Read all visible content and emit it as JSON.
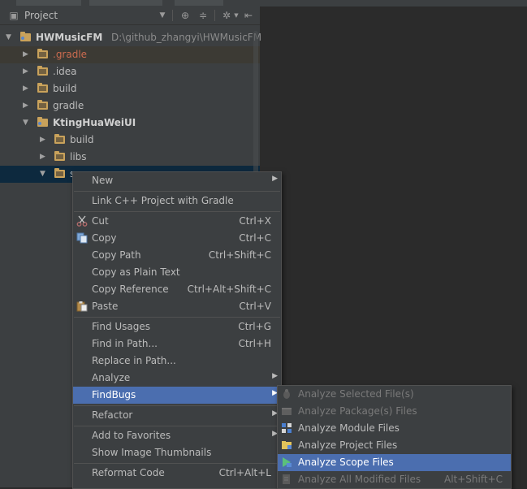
{
  "panel": {
    "title": "Project"
  },
  "tree": [
    {
      "label": "HWMusicFM",
      "path": "D:\\github_zhangyi\\HWMusicFM",
      "depth": 0,
      "expanded": true,
      "bold": true,
      "module": true
    },
    {
      "label": ".gradle",
      "depth": 1,
      "expanded": false,
      "excluded": true
    },
    {
      "label": ".idea",
      "depth": 1,
      "expanded": false
    },
    {
      "label": "build",
      "depth": 1,
      "expanded": false
    },
    {
      "label": "gradle",
      "depth": 1,
      "expanded": false
    },
    {
      "label": "KtingHuaWeiUI",
      "depth": 1,
      "expanded": true,
      "bold": true,
      "module": true
    },
    {
      "label": "build",
      "depth": 2,
      "expanded": false
    },
    {
      "label": "libs",
      "depth": 2,
      "expanded": false
    },
    {
      "label": "src",
      "depth": 2,
      "expanded": true,
      "selected": true
    }
  ],
  "context_menu": [
    {
      "label": "New",
      "shortcut": "",
      "submenu": true
    },
    {
      "separator": true
    },
    {
      "label": "Link C++ Project with Gradle",
      "shortcut": ""
    },
    {
      "separator": true
    },
    {
      "label": "Cut",
      "shortcut": "Ctrl+X",
      "icon": "scissors-icon"
    },
    {
      "label": "Copy",
      "shortcut": "Ctrl+C",
      "icon": "copy-icon"
    },
    {
      "label": "Copy Path",
      "shortcut": "Ctrl+Shift+C"
    },
    {
      "label": "Copy as Plain Text",
      "shortcut": ""
    },
    {
      "label": "Copy Reference",
      "shortcut": "Ctrl+Alt+Shift+C"
    },
    {
      "label": "Paste",
      "shortcut": "Ctrl+V",
      "icon": "paste-icon"
    },
    {
      "separator": true
    },
    {
      "label": "Find Usages",
      "shortcut": "Ctrl+G"
    },
    {
      "label": "Find in Path...",
      "shortcut": "Ctrl+H"
    },
    {
      "label": "Replace in Path...",
      "shortcut": ""
    },
    {
      "label": "Analyze",
      "shortcut": "",
      "submenu": true
    },
    {
      "label": "FindBugs",
      "shortcut": "",
      "submenu": true,
      "highlighted": true
    },
    {
      "separator": true
    },
    {
      "label": "Refactor",
      "shortcut": "",
      "submenu": true
    },
    {
      "separator": true
    },
    {
      "label": "Add to Favorites",
      "shortcut": "",
      "submenu": true
    },
    {
      "label": "Show Image Thumbnails",
      "shortcut": ""
    },
    {
      "separator": true
    },
    {
      "label": "Reformat Code",
      "shortcut": "Ctrl+Alt+L"
    }
  ],
  "findbugs_submenu": [
    {
      "label": "Analyze Selected File(s)",
      "shortcut": "",
      "disabled": true,
      "icon": "bug-gray-icon"
    },
    {
      "label": "Analyze Package(s) Files",
      "shortcut": "",
      "disabled": true,
      "icon": "package-gray-icon"
    },
    {
      "label": "Analyze Module Files",
      "shortcut": "",
      "icon": "module-grid-icon"
    },
    {
      "label": "Analyze Project Files",
      "shortcut": "",
      "icon": "project-folder-icon"
    },
    {
      "label": "Analyze Scope Files",
      "shortcut": "",
      "highlighted": true,
      "icon": "scope-icon"
    },
    {
      "label": "Analyze All Modified Files",
      "shortcut": "Alt+Shift+C",
      "disabled": true,
      "icon": "modified-gray-icon"
    }
  ],
  "colors": {
    "panel_bg": "#3c3f41",
    "editor_bg": "#2b2b2b",
    "selection": "#0d293e",
    "highlight": "#4b6eaf",
    "folder": "#c9a25b"
  }
}
